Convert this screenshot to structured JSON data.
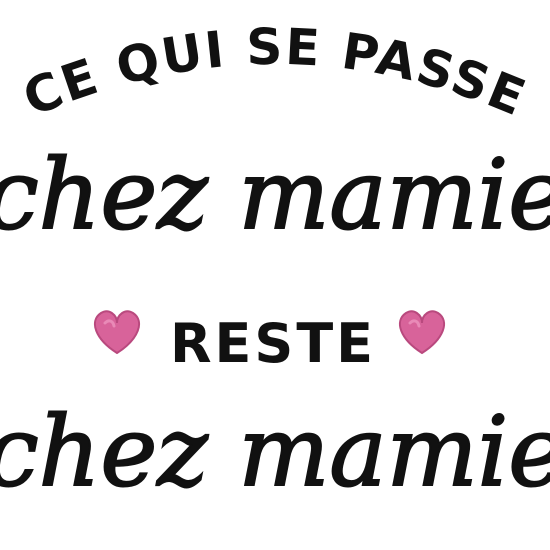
{
  "quote": {
    "line1": "CE QUI SE PASSE",
    "line2": "chez mamie",
    "line3": "RESTE",
    "line4": "chez mamie"
  },
  "colors": {
    "ink": "#111111",
    "heart": "#d8639a",
    "heart_dark": "#b9497e",
    "background": "#ffffff"
  },
  "icons": {
    "left": "heart-icon",
    "right": "heart-icon"
  }
}
